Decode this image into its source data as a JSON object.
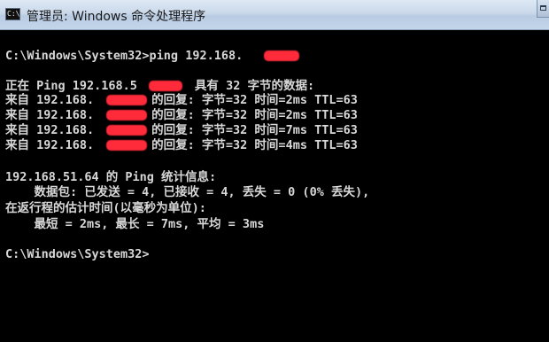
{
  "window": {
    "title": "管理员: Windows 命令处理程序",
    "icon_label": "C:\\"
  },
  "console": {
    "lines": [
      "C:\\Windows\\System32>ping 192.168.",
      "正在 Ping 192.168.5        具有 32 字节的数据:",
      "来自 192.168.        的回复: 字节=32 时间=2ms TTL=63",
      "来自 192.168.        的回复: 字节=32 时间=2ms TTL=63",
      "来自 192.168.        的回复: 字节=32 时间=7ms TTL=63",
      "来自 192.168.        的回复: 字节=32 时间=4ms TTL=63",
      "192.168.51.64 的 Ping 统计信息:",
      "    数据包: 已发送 = 4, 已接收 = 4, 丢失 = 0 (0% 丢失),",
      "在返行程的估计时间(以毫秒为单位):",
      "    最短 = 2ms, 最长 = 7ms, 平均 = 3ms",
      "C:\\Windows\\System32>"
    ]
  },
  "colors": {
    "console_bg": "#000000",
    "console_text": "#d8d8d8",
    "redaction": "#ff2a3a"
  }
}
